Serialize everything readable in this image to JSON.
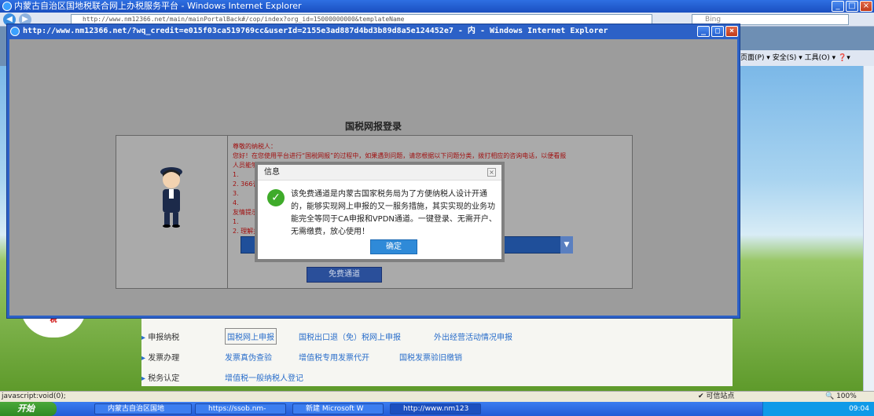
{
  "outer_window": {
    "title": "内蒙古自治区国地税联合网上办税服务平台 - Windows Internet Explorer",
    "address": "http://www.nm12366.net/main/mainPortalBack#/cop/index?org_id=15000000000&templateName",
    "search_placeholder": "Bing",
    "command_bar": "页面(P) ▾ 安全(S) ▾ 工具(O) ▾ ❓▾"
  },
  "inner_window": {
    "title": "http://www.nm12366.net/?wq_credit=e015f03ca519769cc&userId=2155e3ad887d4bd3b89d8a5e124452e7 - 内 - Windows Internet Explorer"
  },
  "login_page": {
    "title": "国税网报登录",
    "notice_lines": [
      "尊敬的纳税人：",
      "    您好！在您使用平台进行“国税网报”的过程中，如果遇到问题，请您根据以下问题分类，拨打相应的咨询电话，以便看报",
      "人员能够为您提供相应的服务：",
      "  1.",
      "  2.                                                                   366咨询，一般纳税人请拨打95113咨询。",
      "  3.",
      "  4.",
      "友情提示",
      "  1.",
      "  2.                                                                       理解并拨打相应的客服电话咨询，谢谢！"
    ],
    "free_button": "免费通道"
  },
  "dialog": {
    "title": "信息",
    "close": "×",
    "message": "该免费通道是内蒙古国家税务局为了方便纳税人设计开通的，能够实现网上申报的又一服务措施，其实实现的业务功能完全等同于CA申报和VPDN通道。一键登录、无需开户、无需缴费，放心使用！",
    "ok_label": "确定"
  },
  "background_menu": {
    "rows": [
      {
        "label": "申报纳税",
        "links": [
          "国税网上申报",
          "国税出口退（免）税网上申报",
          "外出经营活动情况申报"
        ]
      },
      {
        "label": "发票办理",
        "links": [
          "发票真伪查验",
          "增值税专用发票代开",
          "国税发票验旧缴销"
        ]
      },
      {
        "label": "税务认定",
        "links": [
          "增值税一般纳税人登记"
        ]
      }
    ]
  },
  "status_bar": {
    "left": "javascript:void(0);",
    "zone": "可信站点",
    "zoom": "100%"
  },
  "taskbar": {
    "start": "开始",
    "tasks": [
      "内蒙古自治区国地",
      "https://ssob.nm-",
      "新建 Microsoft W",
      "http://www.nm123"
    ],
    "clock": "09:04"
  }
}
